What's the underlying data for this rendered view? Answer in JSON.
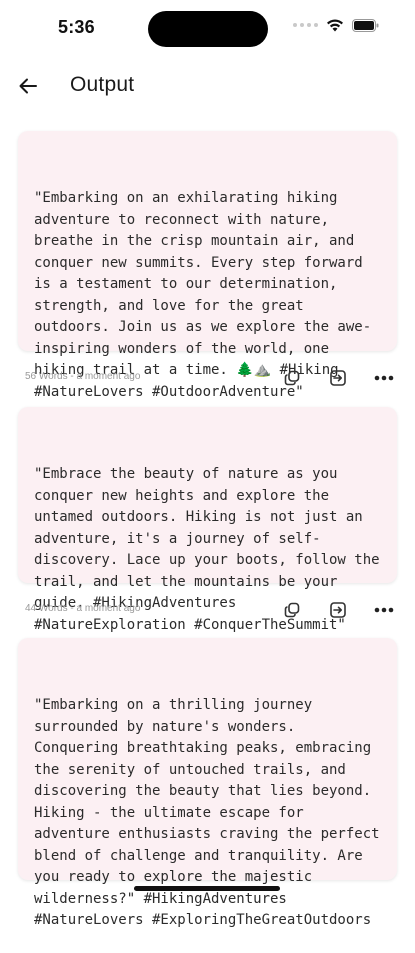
{
  "status_bar": {
    "time": "5:36"
  },
  "header": {
    "title": "Output",
    "back_icon": "arrow-left-icon"
  },
  "outputs": [
    {
      "text": "\"Embarking on an exhilarating hiking adventure to reconnect with nature, breathe in the crisp mountain air, and conquer new summits. Every step forward is a testament to our determination, strength, and love for the great outdoors. Join us as we explore the awe-inspiring wonders of the world, one hiking trail at a time. 🌲⛰️ #Hiking #NatureLovers #OutdoorAdventure\"",
      "meta": "56 Words - a moment ago"
    },
    {
      "text": "\"Embrace the beauty of nature as you conquer new heights and explore the untamed outdoors. Hiking is not just an adventure, it's a journey of self-discovery. Lace up your boots, follow the trail, and let the mountains be your guide. #HikingAdventures #NatureExploration #ConquerTheSummit\"",
      "meta": "44 Words - a moment ago"
    },
    {
      "text": "\"Embarking on a thrilling journey surrounded by nature's wonders. Conquering breathtaking peaks, embracing the serenity of untouched trails, and discovering the beauty that lies beyond. Hiking - the ultimate escape for adventure enthusiasts craving the perfect blend of challenge and tranquility. Are you ready to explore the majestic wilderness?\" #HikingAdventures #NatureLovers #ExploringTheGreatOutdoors"
    }
  ],
  "actions": {
    "copy_icon": "copy-icon",
    "export_icon": "export-icon",
    "more_icon": "more-dots-icon"
  },
  "colors": {
    "card_bg": "#fcf0f3",
    "meta": "#9a9a9a"
  }
}
